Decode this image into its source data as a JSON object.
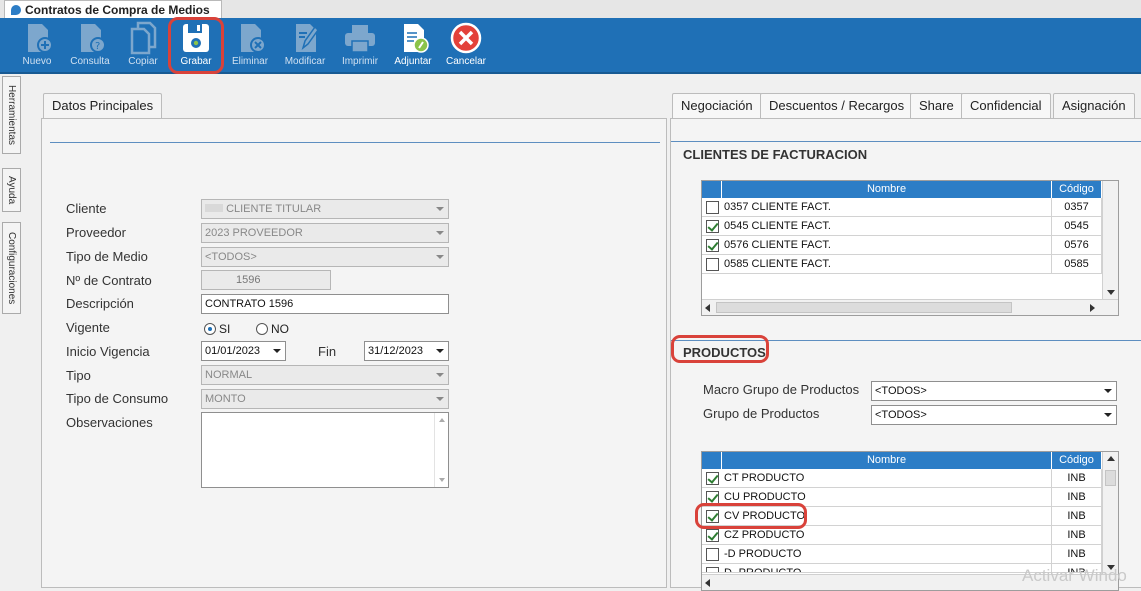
{
  "window": {
    "title": "Contratos de Compra de Medios"
  },
  "toolbar": {
    "buttons": [
      {
        "label": "Nuevo",
        "icon": "doc-plus-icon",
        "enabled": false
      },
      {
        "label": "Consulta",
        "icon": "doc-question-icon",
        "enabled": false
      },
      {
        "label": "Copiar",
        "icon": "copy-icon",
        "enabled": false
      },
      {
        "label": "Grabar",
        "icon": "floppy-save-icon",
        "enabled": true
      },
      {
        "label": "Eliminar",
        "icon": "doc-delete-icon",
        "enabled": false
      },
      {
        "label": "Modificar",
        "icon": "doc-edit-icon",
        "enabled": false
      },
      {
        "label": "Imprimir",
        "icon": "printer-icon",
        "enabled": false
      },
      {
        "label": "Adjuntar",
        "icon": "doc-attach-icon",
        "enabled": true
      },
      {
        "label": "Cancelar",
        "icon": "cancel-icon",
        "enabled": true
      }
    ]
  },
  "side_tabs": [
    "Herramientas",
    "Ayuda",
    "Configuraciones"
  ],
  "left": {
    "tab": "Datos Principales",
    "fields": {
      "cliente": {
        "label": "Cliente",
        "value": "CLIENTE TITULAR"
      },
      "proveedor": {
        "label": "Proveedor",
        "value": "2023 PROVEEDOR"
      },
      "tipo_medio": {
        "label": "Tipo de Medio",
        "value": "<TODOS>"
      },
      "nro_contrato": {
        "label": "Nº de Contrato",
        "value": "1596"
      },
      "descripcion": {
        "label": "Descripción",
        "value": "CONTRATO 1596"
      },
      "vigente": {
        "label": "Vigente",
        "opt_si": "SI",
        "opt_no": "NO",
        "selected": "SI"
      },
      "inicio": {
        "label": "Inicio Vigencia",
        "value": "01/01/2023"
      },
      "fin": {
        "label": "Fin",
        "value": "31/12/2023"
      },
      "tipo": {
        "label": "Tipo",
        "value": "NORMAL"
      },
      "tipo_consumo": {
        "label": "Tipo de Consumo",
        "value": "MONTO"
      },
      "observaciones": {
        "label": "Observaciones",
        "value": ""
      }
    }
  },
  "right": {
    "tabs": [
      "Negociación",
      "Descuentos / Recargos",
      "Share",
      "Confidencial",
      "Asignación"
    ],
    "active_tab": "Asignación",
    "clientes": {
      "title": "CLIENTES DE FACTURACION",
      "columns": [
        "Nombre",
        "Código"
      ],
      "rows": [
        {
          "checked": false,
          "nombre": "0357 CLIENTE FACT.",
          "codigo": "0357"
        },
        {
          "checked": true,
          "nombre": "0545 CLIENTE FACT.",
          "codigo": "0545"
        },
        {
          "checked": true,
          "nombre": "0576 CLIENTE FACT.",
          "codigo": "0576"
        },
        {
          "checked": false,
          "nombre": "0585 CLIENTE FACT.",
          "codigo": "0585"
        }
      ]
    },
    "productos": {
      "title": "PRODUCTOS",
      "macro_label": "Macro Grupo de Productos",
      "macro_value": "<TODOS>",
      "grupo_label": "Grupo de Productos",
      "grupo_value": "<TODOS>",
      "columns": [
        "Nombre",
        "Código"
      ],
      "rows": [
        {
          "checked": true,
          "nombre": "CT PRODUCTO",
          "codigo": "INB"
        },
        {
          "checked": true,
          "nombre": "CU PRODUCTO",
          "codigo": "INB"
        },
        {
          "checked": true,
          "nombre": "CV PRODUCTO",
          "codigo": "INB"
        },
        {
          "checked": true,
          "nombre": "CZ PRODUCTO",
          "codigo": "INB"
        },
        {
          "checked": false,
          "nombre": "-D PRODUCTO",
          "codigo": "INB"
        },
        {
          "checked": false,
          "nombre": "D- PRODUCTO",
          "codigo": "INB"
        }
      ]
    }
  },
  "watermark": "Activar Windo",
  "colors": {
    "toolbar": "#1f70b6",
    "grid_header": "#2c7dc6",
    "highlight": "#d9423a",
    "check": "#2e7d32"
  }
}
